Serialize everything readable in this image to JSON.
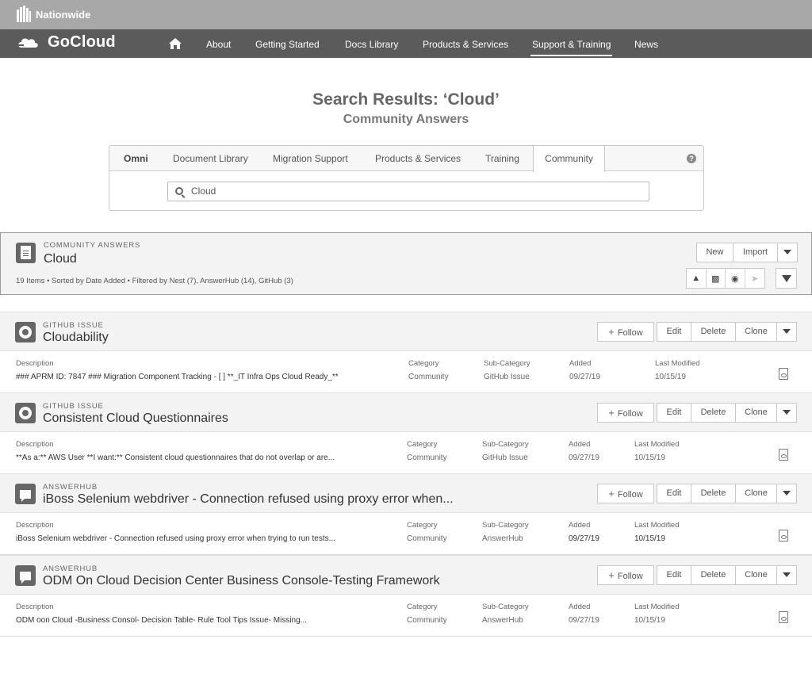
{
  "brand": {
    "name": "Nationwide"
  },
  "nav": {
    "logo": "GoCloud",
    "items": [
      "About",
      "Getting Started",
      "Docs Library",
      "Products & Services",
      "Support & Training",
      "News"
    ],
    "active_index": 4
  },
  "page": {
    "title": "Search Results: ‘Cloud’",
    "subtitle": "Community Answers"
  },
  "search": {
    "tabs": [
      "Omni",
      "Document Library",
      "Migration Support",
      "Products & Services",
      "Training",
      "Community"
    ],
    "selected_tab": "Community",
    "value": "Cloud"
  },
  "header": {
    "kicker": "COMMUNITY ANSWERS",
    "title": "Cloud",
    "meta": "19 Items • Sorted by Date Added • Filtered by Nest (7), AnswerHub (14), GitHub (3)",
    "buttons": {
      "new": "New",
      "import": "Import"
    }
  },
  "actions": {
    "follow": "Follow",
    "edit": "Edit",
    "delete": "Delete",
    "clone": "Clone"
  },
  "columns": {
    "description": "Description",
    "category": "Category",
    "subcategory": "Sub-Category",
    "added": "Added",
    "modified": "Last Modified"
  },
  "items": [
    {
      "kicker": "GITHUB ISSUE",
      "icon": "github-icon",
      "title": "Cloudability",
      "description": "### APRM ID: 7847 ### Migration Component Tracking - [ ] **_IT Infra Ops Cloud Ready_**",
      "category": "Community",
      "subcategory": "GitHub Issue",
      "added": "09/27/19",
      "modified": "10/15/19"
    },
    {
      "kicker": "GITHUB ISSUE",
      "icon": "github-icon",
      "title": "Consistent Cloud Questionnaires",
      "description": "**As a:** AWS User **I want:** Consistent cloud questionnaires that do not overlap or are...",
      "category": "Community",
      "subcategory": "GitHub Issue",
      "added": "09/27/19",
      "modified": "10/15/19"
    },
    {
      "kicker": "ANSWERHUB",
      "icon": "chat-icon",
      "title": "iBoss Selenium webdriver - Connection refused using proxy error when...",
      "description": "iBoss Selenium webdriver - Connection refused using proxy error when trying to run tests...",
      "category": "Community",
      "subcategory": "AnswerHub",
      "added": "09/27/19",
      "modified": "10/15/19"
    },
    {
      "kicker": "ANSWERHUB",
      "icon": "chat-icon",
      "title": "ODM On Cloud Decision Center Business Console-Testing Framework",
      "description": "ODM oon Cloud -Business Consol- Decision Table- Rule Tool Tips Issue- Missing...",
      "category": "Community",
      "subcategory": "AnswerHub",
      "added": "09/27/19",
      "modified": "10/15/19"
    }
  ]
}
